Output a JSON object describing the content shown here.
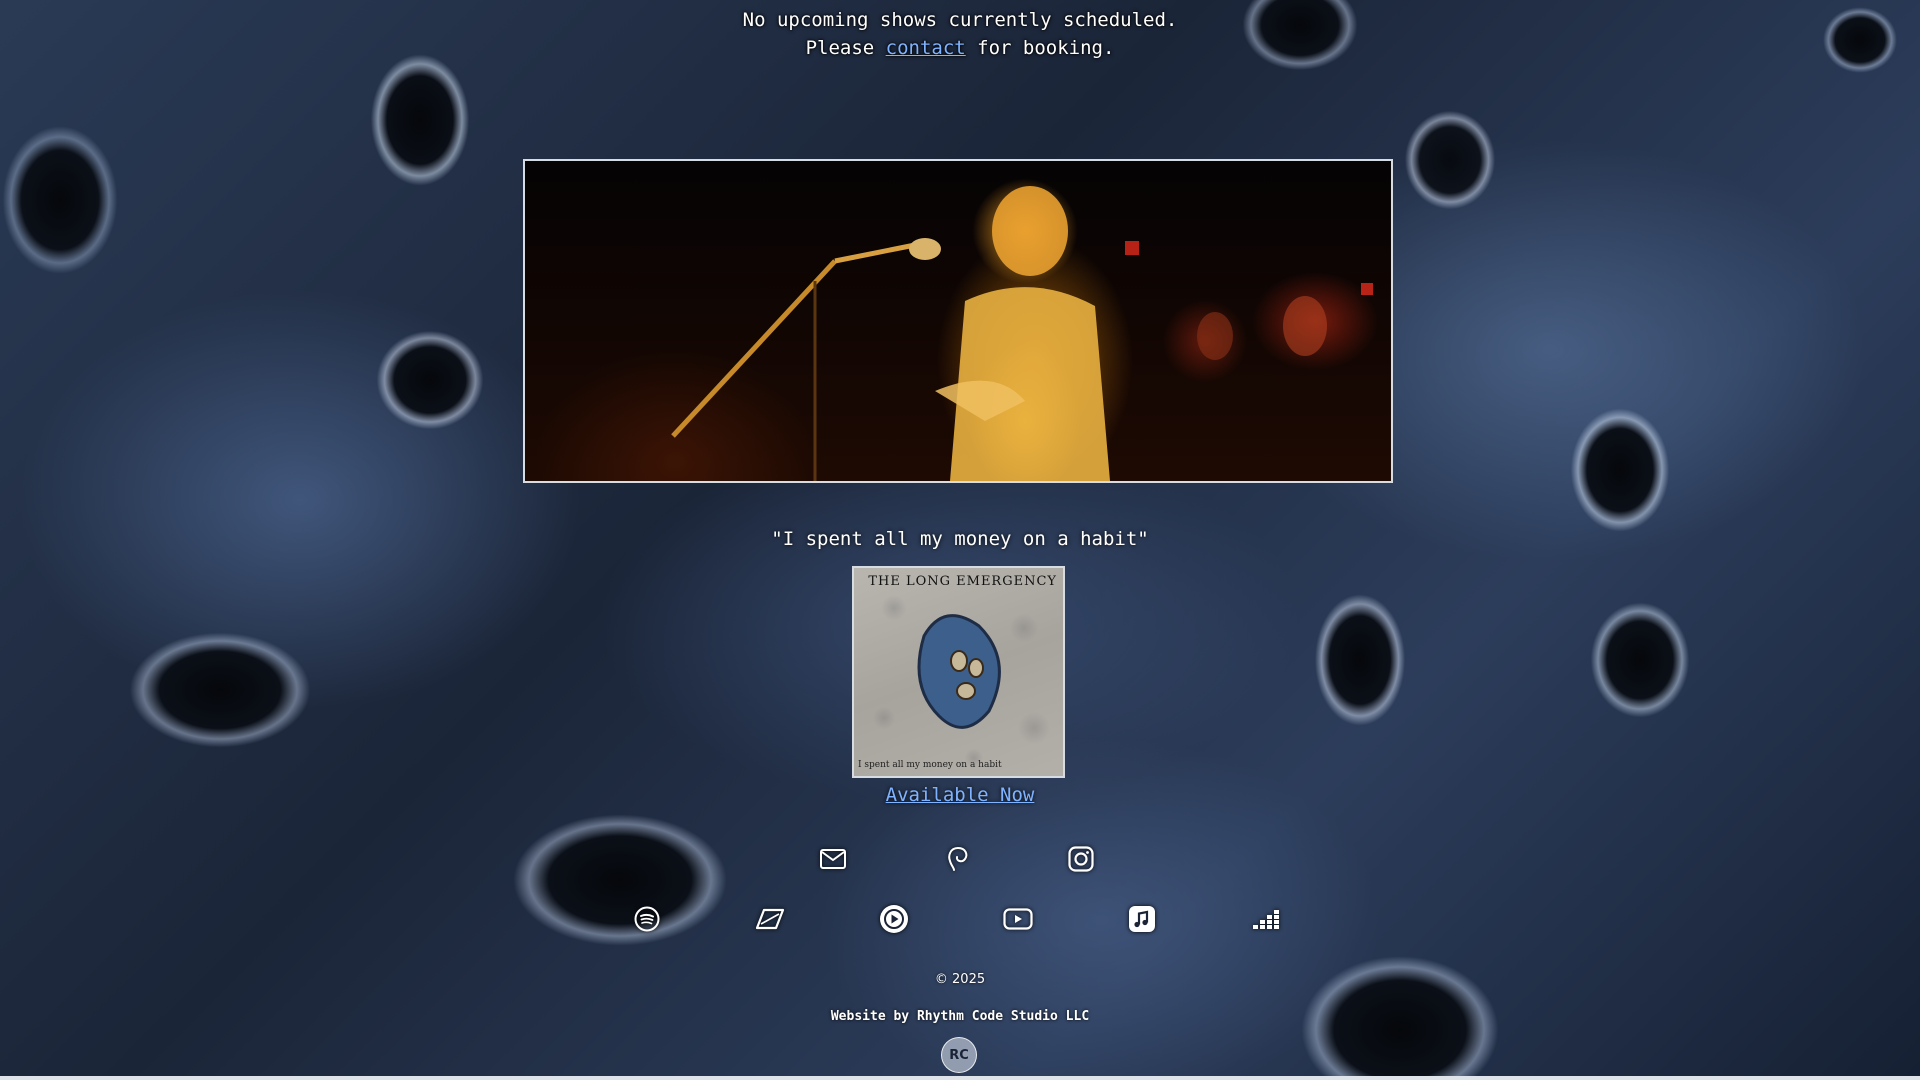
{
  "shows": {
    "line1": "No upcoming shows currently scheduled.",
    "line2_prefix": "Please ",
    "contact_link": "contact",
    "line2_suffix": " for booking."
  },
  "release": {
    "title": "\"I spent all my money on a habit\"",
    "cover_band_text": "THE LONG EMERGENCY",
    "cover_subtitle": "I spent all my money on a habit",
    "available_link": "Available Now"
  },
  "social_icons": [
    "email-icon",
    "threads-icon",
    "instagram-icon"
  ],
  "streaming_icons": [
    "spotify-icon",
    "tidal-icon",
    "music-play-icon",
    "youtube-icon",
    "apple-music-icon",
    "deezer-icon"
  ],
  "footer": {
    "copyright": "© 2025",
    "credit": "Website by Rhythm Code Studio LLC",
    "logo_text": "RC"
  },
  "colors": {
    "link": "#7fb3ff",
    "text": "#ffffff",
    "frame_border": "#d7dbe2"
  }
}
